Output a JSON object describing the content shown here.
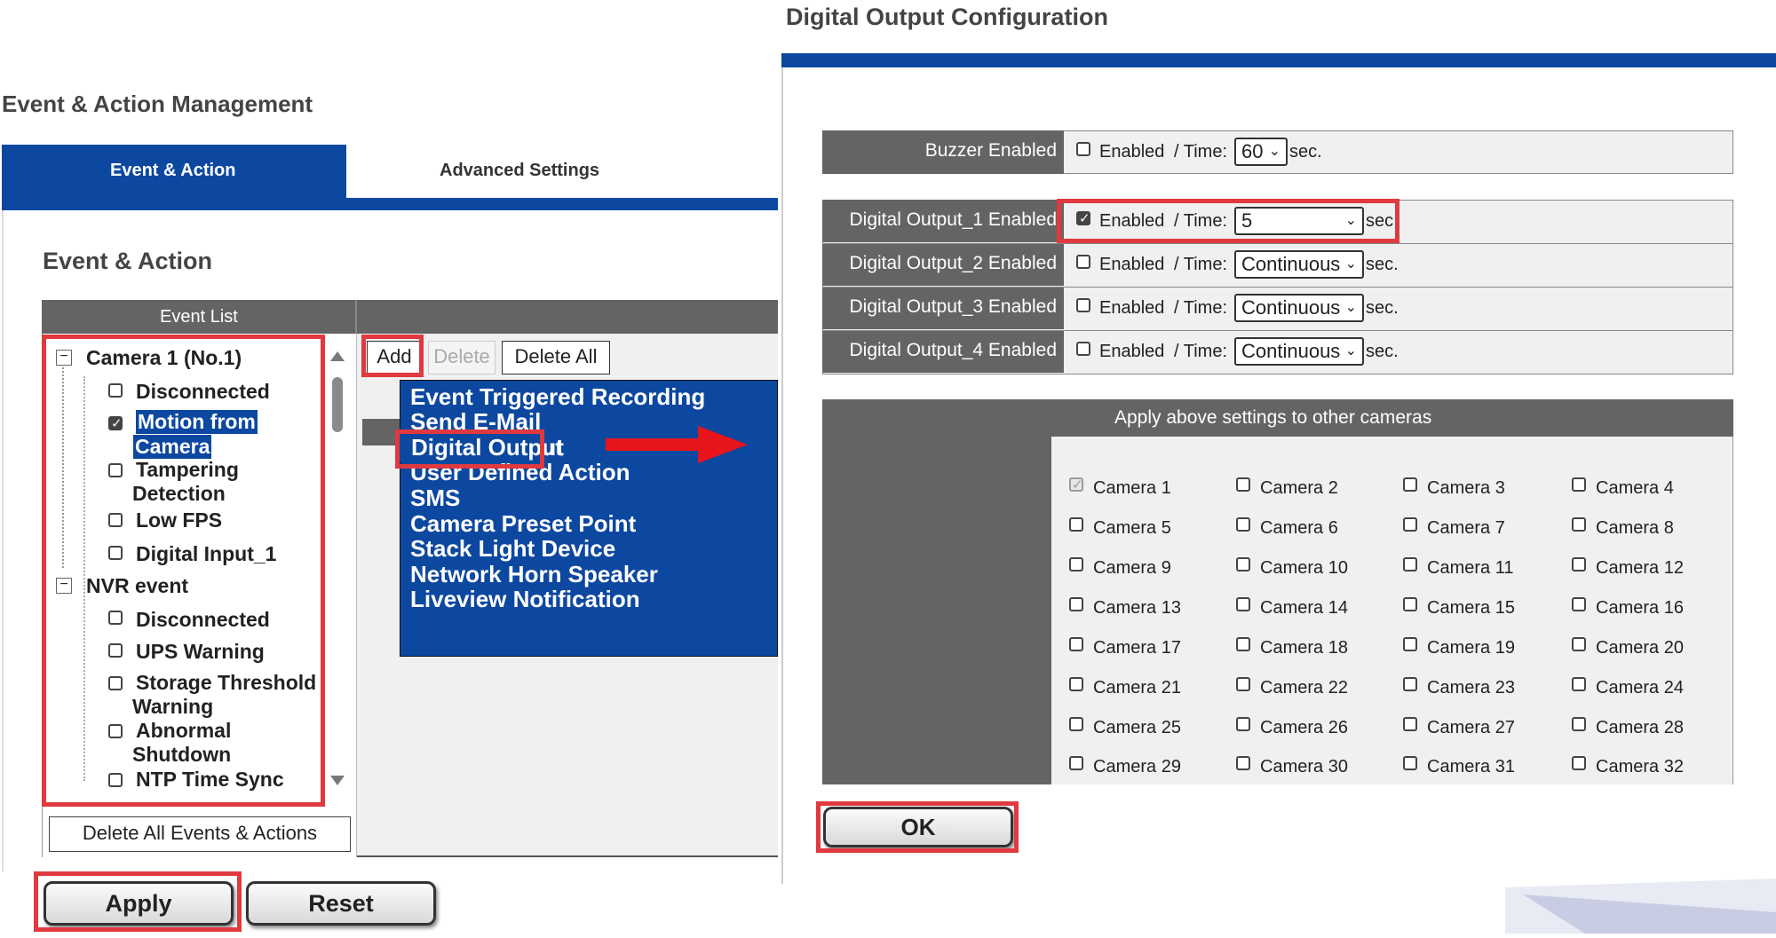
{
  "left_panel": {
    "page_title": "Event & Action Management",
    "tabs": [
      {
        "label": "Event & Action",
        "active": true
      },
      {
        "label": "Advanced Settings",
        "active": false
      }
    ],
    "section_title": "Event & Action",
    "event_list_header": "Event List",
    "tree": {
      "camera_group": "Camera 1 (No.1)",
      "camera_items": [
        {
          "label": "Disconnected",
          "checked": false
        },
        {
          "label_line1": "Motion from",
          "label_line2": "Camera",
          "checked": true,
          "selected": true
        },
        {
          "label_line1": "Tampering",
          "label_line2": "Detection",
          "checked": false
        },
        {
          "label": "Low FPS",
          "checked": false
        },
        {
          "label": "Digital Input_1",
          "checked": false
        }
      ],
      "nvr_group": "NVR event",
      "nvr_items": [
        {
          "label": "Disconnected",
          "checked": false
        },
        {
          "label": "UPS Warning",
          "checked": false
        },
        {
          "label_line1": "Storage Threshold",
          "label_line2": "Warning",
          "checked": false
        },
        {
          "label_line1": "Abnormal",
          "label_line2": "Shutdown",
          "checked": false
        },
        {
          "label": "NTP Time Sync",
          "checked": false
        }
      ]
    },
    "toolbar": {
      "add": "Add",
      "delete": "Delete",
      "delete_all": "Delete All"
    },
    "actions": [
      "Event Triggered Recording",
      "Send E-Mail",
      "Digital Output",
      "User Defined Action",
      "SMS",
      "Camera Preset Point",
      "Stack Light Device",
      "Network Horn Speaker",
      "Liveview Notification"
    ],
    "delete_all_events": "Delete All Events & Actions",
    "apply": "Apply",
    "reset": "Reset"
  },
  "right_panel": {
    "title": "Digital Output Configuration",
    "enabled_text": "Enabled",
    "time_text": "/ Time:",
    "sec_text": "sec.",
    "rows": [
      {
        "label": "Buzzer Enabled",
        "checked": false,
        "time": "60",
        "sec": "sec."
      },
      {
        "label": "Digital Output_1 Enabled",
        "checked": true,
        "time": "5",
        "sec": "sec"
      },
      {
        "label": "Digital Output_2 Enabled",
        "checked": false,
        "time": "Continuous",
        "sec": "sec."
      },
      {
        "label": "Digital Output_3 Enabled",
        "checked": false,
        "time": "Continuous",
        "sec": "sec."
      },
      {
        "label": "Digital Output_4 Enabled",
        "checked": false,
        "time": "Continuous",
        "sec": "sec."
      }
    ],
    "apply_header": "Apply above settings to other cameras",
    "cameras": [
      "Camera 1",
      "Camera 2",
      "Camera 3",
      "Camera 4",
      "Camera 5",
      "Camera 6",
      "Camera 7",
      "Camera 8",
      "Camera 9",
      "Camera 10",
      "Camera 11",
      "Camera 12",
      "Camera 13",
      "Camera 14",
      "Camera 15",
      "Camera 16",
      "Camera 17",
      "Camera 18",
      "Camera 19",
      "Camera 20",
      "Camera 21",
      "Camera 22",
      "Camera 23",
      "Camera 24",
      "Camera 25",
      "Camera 26",
      "Camera 27",
      "Camera 28",
      "Camera 29",
      "Camera 30",
      "Camera 31",
      "Camera 32"
    ],
    "ok": "OK"
  },
  "colors": {
    "brand_blue": "#0d48a0",
    "header_gray": "#646464",
    "highlight_red": "#e0393f"
  }
}
